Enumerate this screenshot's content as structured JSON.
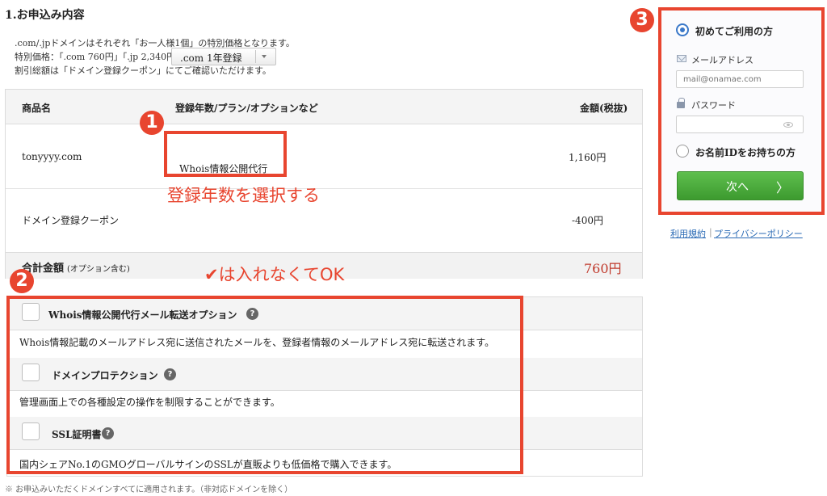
{
  "section": {
    "title": "1.お申込み内容",
    "intro": [
      ".com/.jpドメインはそれぞれ「お一人様1個」の特別価格となります。",
      "特別価格：「.com 760円」「.jp 2,340円」",
      "割引総額は「ドメイン登録クーポン」にてご確認いただけます。"
    ]
  },
  "order_table": {
    "headers": {
      "product": "商品名",
      "plan": "登録年数/プラン/オプションなど",
      "price": "金額(税抜)"
    },
    "domain_row": {
      "name": "tonyyyy.com",
      "select_value": ".com 1年登録",
      "whois": "Whois情報公開代行",
      "price": "1,160円"
    },
    "coupon_row": {
      "name": "ドメイン登録クーポン",
      "price": "-400円"
    },
    "total_row": {
      "label": "合計金額",
      "note": "(オプション含む)",
      "price": "760円"
    }
  },
  "annotations": {
    "badge1": "1",
    "badge2": "2",
    "badge3": "3",
    "select_hint": "登録年数を選択する",
    "check_hint": "✔は入れなくてOK"
  },
  "options": [
    {
      "title": "Whois情報公開代行メール転送オプション",
      "desc": "Whois情報記載のメールアドレス宛に送信されたメールを、登録者情報のメールアドレス宛に転送されます。"
    },
    {
      "title": "ドメインプロテクション",
      "desc": "管理画面上での各種設定の操作を制限することができます。"
    },
    {
      "title": "SSL証明書",
      "desc": "国内シェアNo.1のGMOグローバルサインのSSLが直販よりも低価格で購入できます。"
    }
  ],
  "help_glyph": "?",
  "footnote": "※ お申込みいただくドメインすべてに適用されます。（非対応ドメインを除く）",
  "login": {
    "first_time_label": "初めてご利用の方",
    "email_label": "メールアドレス",
    "email_placeholder": "mail@onamae.com",
    "password_label": "パスワード",
    "have_id_label": "お名前IDをお持ちの方",
    "next_label": "次へ",
    "next_chevron": "〉",
    "terms_link": "利用規約",
    "privacy_link": "プライバシーポリシー",
    "link_separator": "|"
  },
  "colors": {
    "annotation_red": "#e8452f",
    "next_green": "#4caf3e",
    "radio_blue": "#3a78c9",
    "link_blue": "#2a6ab5"
  },
  "icons": [
    "mail-icon",
    "lock-icon",
    "eye-icon",
    "help-icon",
    "chevron-right-icon",
    "dropdown-arrow-icon"
  ]
}
